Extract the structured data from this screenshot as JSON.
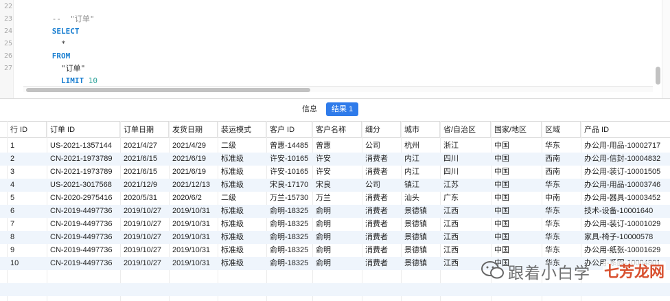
{
  "editor": {
    "line_numbers": [
      "22",
      "23",
      "24",
      "25",
      "26",
      "27"
    ],
    "lines": [
      {
        "parts": [
          {
            "cls": "cmt",
            "text": "--  \"订单\""
          }
        ]
      },
      {
        "parts": [
          {
            "cls": "kw",
            "text": "SELECT"
          }
        ]
      },
      {
        "parts": [
          {
            "cls": "plain",
            "text": "  *"
          }
        ]
      },
      {
        "parts": [
          {
            "cls": "kw",
            "text": "FROM"
          }
        ]
      },
      {
        "parts": [
          {
            "cls": "plain",
            "text": "  \"订单\""
          }
        ]
      },
      {
        "parts": [
          {
            "cls": "kw",
            "text": "  LIMIT "
          },
          {
            "cls": "num",
            "text": "10"
          }
        ]
      }
    ]
  },
  "tabs": {
    "info_label": "信息",
    "result_label": "结果 1"
  },
  "table": {
    "columns": [
      "行 ID",
      "订单 ID",
      "订单日期",
      "发货日期",
      "装运模式",
      "客户 ID",
      "客户名称",
      "细分",
      "城市",
      "省/自治区",
      "国家/地区",
      "区域",
      "产品 ID"
    ],
    "rows": [
      [
        "1",
        "US-2021-1357144",
        "2021/4/27",
        "2021/4/29",
        "二级",
        "曾惠-14485",
        "曾惠",
        "公司",
        "杭州",
        "浙江",
        "中国",
        "华东",
        "办公用-用品-10002717"
      ],
      [
        "2",
        "CN-2021-1973789",
        "2021/6/15",
        "2021/6/19",
        "标准级",
        "许安-10165",
        "许安",
        "消费者",
        "内江",
        "四川",
        "中国",
        "西南",
        "办公用-信封-10004832"
      ],
      [
        "3",
        "CN-2021-1973789",
        "2021/6/15",
        "2021/6/19",
        "标准级",
        "许安-10165",
        "许安",
        "消费者",
        "内江",
        "四川",
        "中国",
        "西南",
        "办公用-装订-10001505"
      ],
      [
        "4",
        "US-2021-3017568",
        "2021/12/9",
        "2021/12/13",
        "标准级",
        "宋良-17170",
        "宋良",
        "公司",
        "镇江",
        "江苏",
        "中国",
        "华东",
        "办公用-用品-10003746"
      ],
      [
        "5",
        "CN-2020-2975416",
        "2020/5/31",
        "2020/6/2",
        "二级",
        "万兰-15730",
        "万兰",
        "消费者",
        "汕头",
        "广东",
        "中国",
        "中南",
        "办公用-器具-10003452"
      ],
      [
        "6",
        "CN-2019-4497736",
        "2019/10/27",
        "2019/10/31",
        "标准级",
        "俞明-18325",
        "俞明",
        "消费者",
        "景德镇",
        "江西",
        "中国",
        "华东",
        "技术-设备-10001640"
      ],
      [
        "7",
        "CN-2019-4497736",
        "2019/10/27",
        "2019/10/31",
        "标准级",
        "俞明-18325",
        "俞明",
        "消费者",
        "景德镇",
        "江西",
        "中国",
        "华东",
        "办公用-装订-10001029"
      ],
      [
        "8",
        "CN-2019-4497736",
        "2019/10/27",
        "2019/10/31",
        "标准级",
        "俞明-18325",
        "俞明",
        "消费者",
        "景德镇",
        "江西",
        "中国",
        "华东",
        "家具-椅子-10000578"
      ],
      [
        "9",
        "CN-2019-4497736",
        "2019/10/27",
        "2019/10/31",
        "标准级",
        "俞明-18325",
        "俞明",
        "消费者",
        "景德镇",
        "江西",
        "中国",
        "华东",
        "办公用-纸张-10001629"
      ],
      [
        "10",
        "CN-2019-4497736",
        "2019/10/27",
        "2019/10/31",
        "标准级",
        "俞明-18325",
        "俞明",
        "消费者",
        "景德镇",
        "江西",
        "中国",
        "华东",
        "办公用-系固-10004801"
      ]
    ]
  },
  "watermark": {
    "text": "跟着小白学",
    "site_text": "七芳龙网"
  },
  "colors": {
    "accent": "#2f7bea",
    "row_alt": "#eff5fc",
    "keyword": "#1a7fd1",
    "number": "#2aa198",
    "comment": "#8c8c8c"
  }
}
